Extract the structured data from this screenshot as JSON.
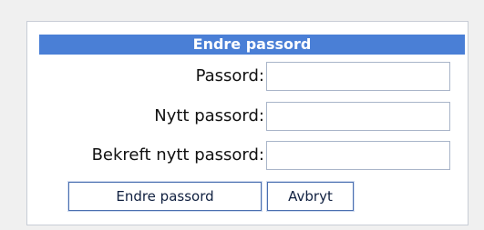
{
  "form": {
    "title": "Endre passord",
    "fields": [
      {
        "label": "Passord:",
        "value": "",
        "placeholder": ""
      },
      {
        "label": "Nytt passord:",
        "value": "",
        "placeholder": ""
      },
      {
        "label": "Bekreft nytt passord:",
        "value": "",
        "placeholder": ""
      }
    ],
    "buttons": {
      "submit": "Endre passord",
      "cancel": "Avbryt"
    }
  },
  "colors": {
    "header_bg": "#4a7fd6",
    "header_text": "#ffffff",
    "page_bg": "#f0f0f0"
  }
}
